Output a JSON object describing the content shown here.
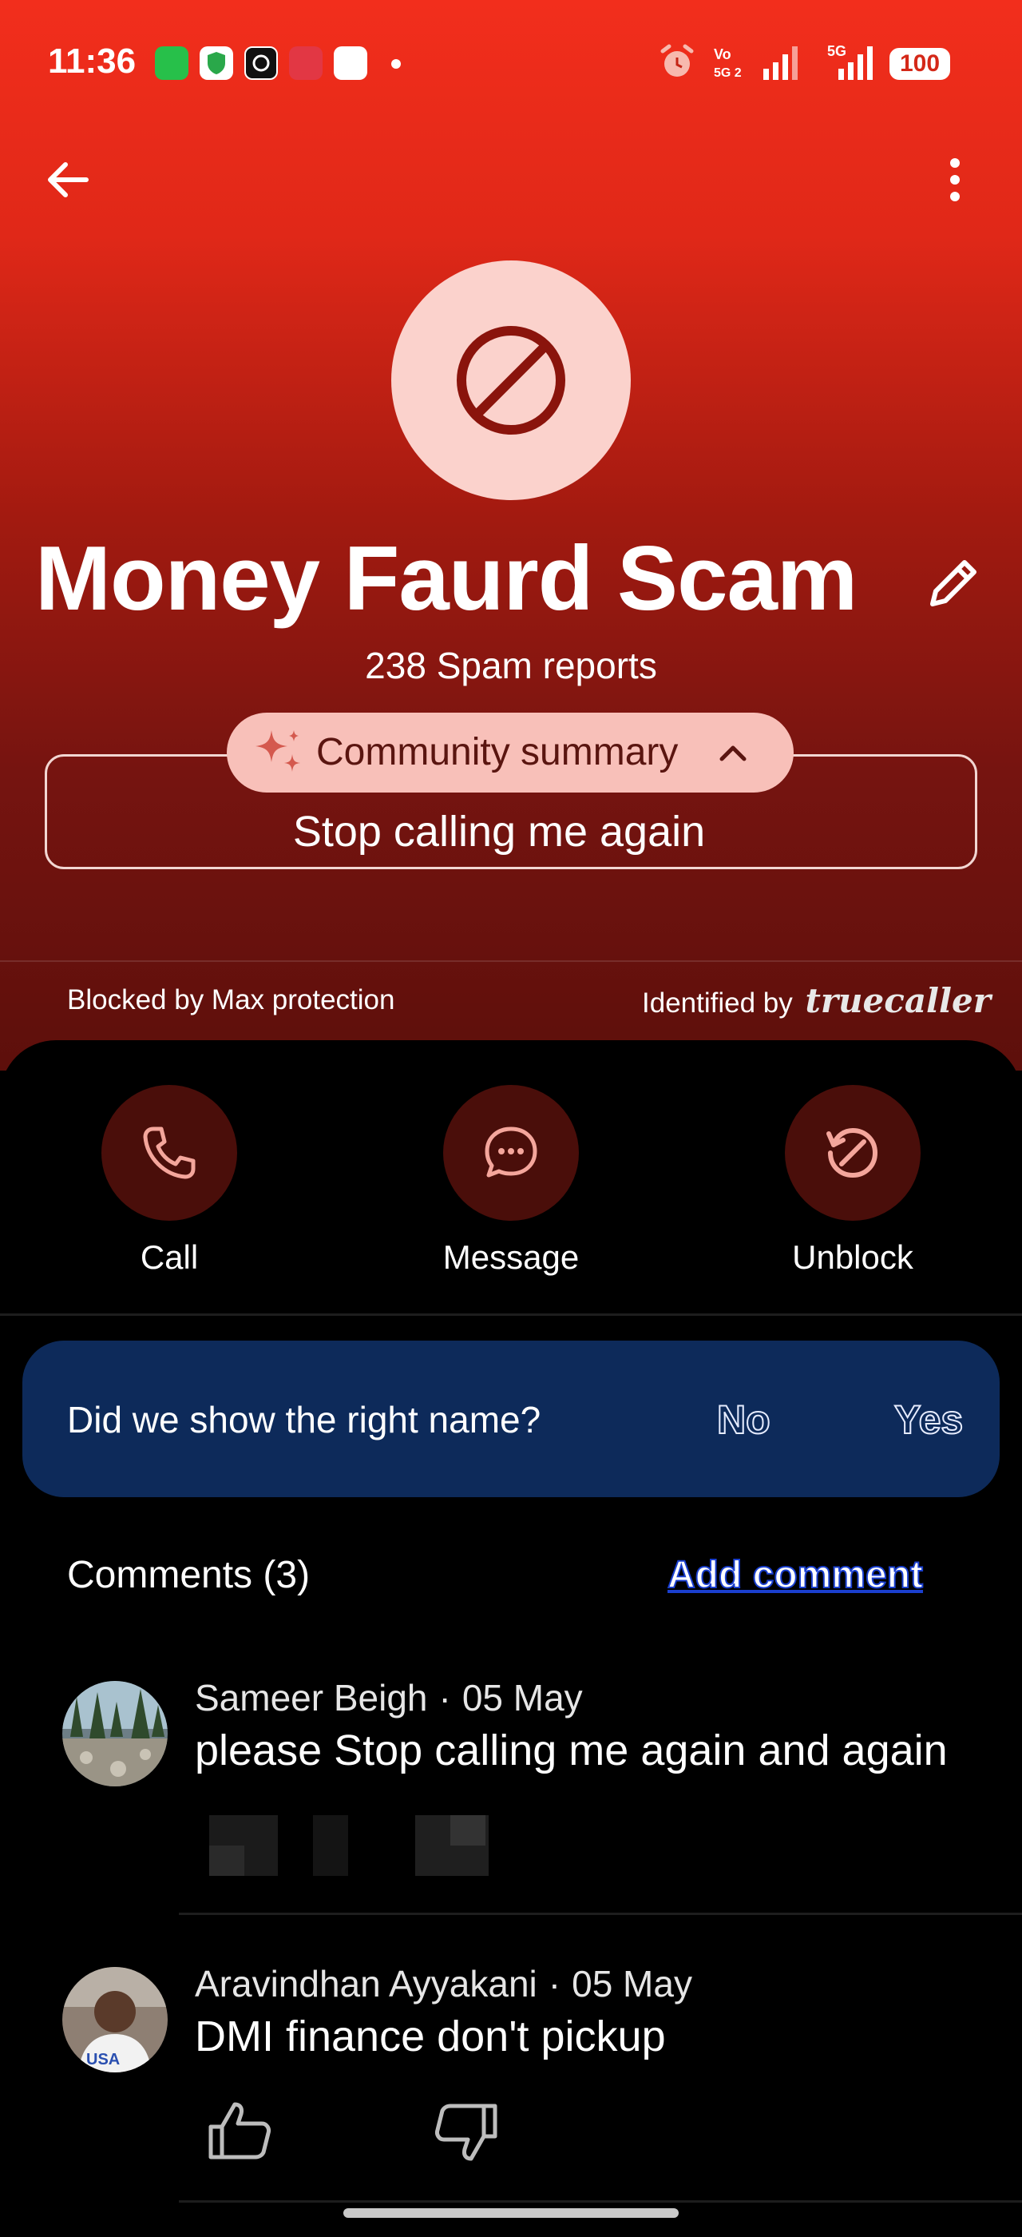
{
  "status_bar": {
    "time": "11:36",
    "battery": "100",
    "icons": [
      "whatsapp-icon",
      "shield-icon",
      "threads-icon",
      "zomato-icon",
      "app-icon",
      "notification-dot",
      "alarm-icon",
      "volte-icon",
      "signal-icon",
      "5g-signal-icon"
    ]
  },
  "header": {
    "back_icon": "back-arrow-icon",
    "more_icon": "more-vertical-icon"
  },
  "contact": {
    "name": "Money Faurd Scam",
    "spam_reports": "238 Spam reports",
    "avatar_icon": "blocked-icon"
  },
  "summary": {
    "pill_label": "Community summary",
    "text": "Stop calling me again"
  },
  "footer_info": {
    "blocked_by": "Blocked by Max protection",
    "identified_by": "Identified by",
    "brand": "truecaller"
  },
  "actions": [
    {
      "label": "Call",
      "icon": "phone-icon"
    },
    {
      "label": "Message",
      "icon": "message-icon"
    },
    {
      "label": "Unblock",
      "icon": "unblock-icon"
    }
  ],
  "question": {
    "text": "Did we show the right name?",
    "no": "No",
    "yes": "Yes"
  },
  "comments": {
    "title": "Comments (3)",
    "add_label": "Add comment",
    "items": [
      {
        "author": "Sameer Beigh",
        "date": "05 May",
        "text": "please Stop calling me again and again"
      },
      {
        "author": "Aravindhan Ayyakani",
        "date": "05 May",
        "text": "DMI finance don't pickup"
      }
    ]
  },
  "colors": {
    "hero_top": "#f22e1c",
    "hero_bottom": "#5d0f0b",
    "action_circle": "#4a0e0a",
    "question_bg": "#0d2a5a",
    "pill_bg": "#f8c0b9"
  }
}
